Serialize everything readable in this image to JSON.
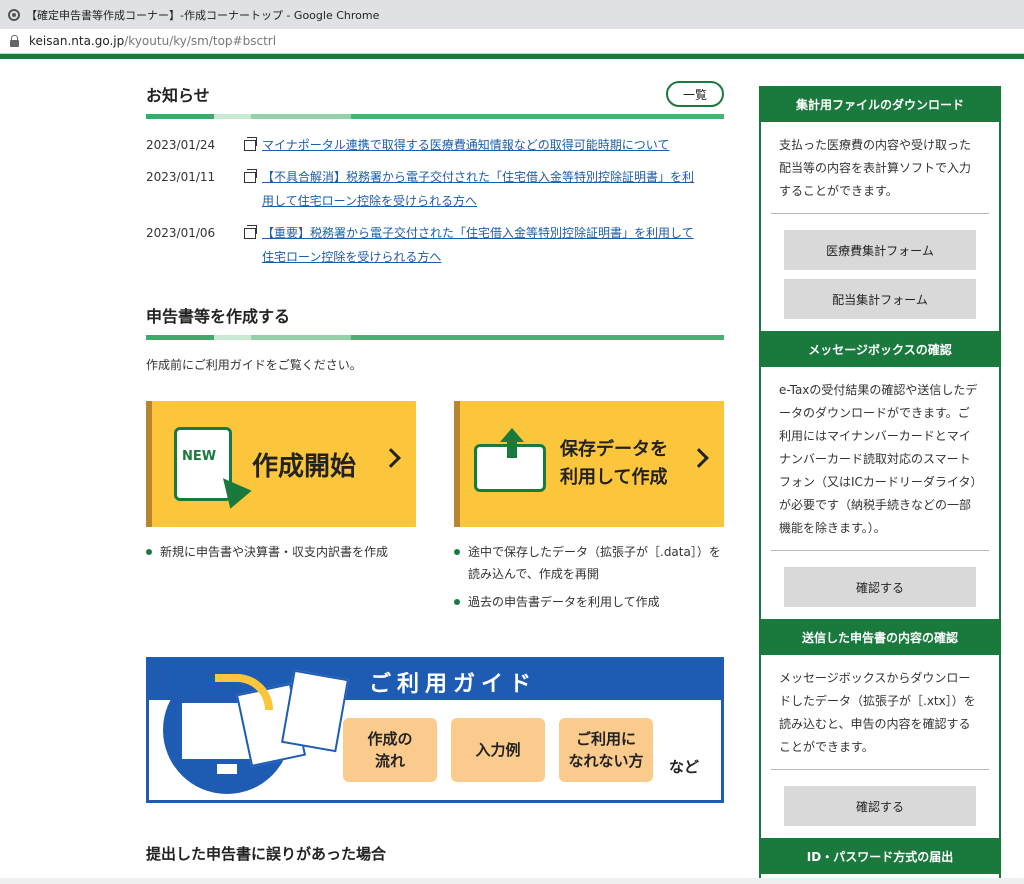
{
  "browser": {
    "window_title": "【確定申告書等作成コーナー】-作成コーナートップ - Google Chrome",
    "url_host": "keisan.nta.go.jp",
    "url_path": "/kyoutu/ky/sm/top#bsctrl"
  },
  "news": {
    "title": "お知らせ",
    "list_button": "一覧",
    "items": [
      {
        "date": "2023/01/24",
        "text": "マイナポータル連携で取得する医療費通知情報などの取得可能時期について"
      },
      {
        "date": "2023/01/11",
        "text": "【不具合解消】税務署から電子交付された「住宅借入金等特別控除証明書」を利用して住宅ローン控除を受けられる方へ"
      },
      {
        "date": "2023/01/06",
        "text": "【重要】税務署から電子交付された「住宅借入金等特別控除証明書」を利用して住宅ローン控除を受けられる方へ"
      }
    ]
  },
  "create": {
    "title": "申告書等を作成する",
    "intro": "作成前にご利用ガイドをご覧ください。",
    "card_new": {
      "icon_text": "NEW",
      "label": "作成開始"
    },
    "card_saved": {
      "line1": "保存データを",
      "line2": "利用して作成"
    },
    "bullets_new": [
      "新規に申告書や決算書・収支内訳書を作成"
    ],
    "bullets_saved": [
      "途中で保存したデータ（拡張子が［.data］）を読み込んで、作成を再開",
      "過去の申告書データを利用して作成"
    ]
  },
  "guide": {
    "title": "ご利用ガイド",
    "pill1": "作成の\n流れ",
    "pill2": "入力例",
    "pill3": "ご利用に\nなれない方",
    "suffix": "など"
  },
  "bottom_title": "提出した申告書に誤りがあった場合",
  "sidebar": {
    "s1_title": "集計用ファイルのダウンロード",
    "s1_text": "支払った医療費の内容や受け取った配当等の内容を表計算ソフトで入力することができます。",
    "s1_btn1": "医療費集計フォーム",
    "s1_btn2": "配当集計フォーム",
    "s2_title": "メッセージボックスの確認",
    "s2_text": "e-Taxの受付結果の確認や送信したデータのダウンロードができます。ご利用にはマイナンバーカードとマイナンバーカード読取対応のスマートフォン（又はICカードリーダライタ）が必要です（納税手続きなどの一部機能を除きます。）。",
    "s2_btn": "確認する",
    "s3_title": "送信した申告書の内容の確認",
    "s3_text": "メッセージボックスからダウンロードしたデータ（拡張子が［.xtx］）を読み込むと、申告の内容を確認することができます。",
    "s3_btn": "確認する",
    "s4_title": "ID・パスワード方式の届出"
  },
  "colors": {
    "brand_green": "#1a7a3e",
    "card_yellow": "#fbc63b",
    "guide_blue": "#1e5cb3",
    "link": "#1a5fa8"
  }
}
